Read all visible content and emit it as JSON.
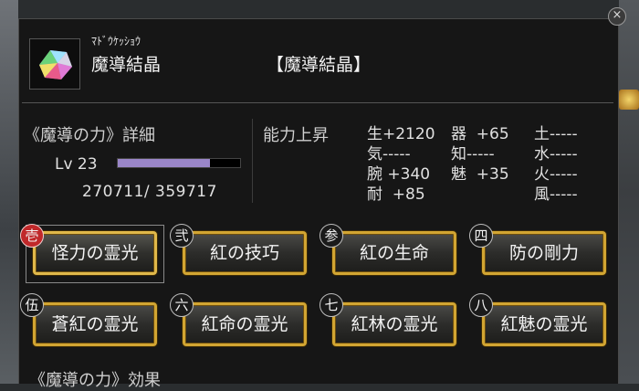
{
  "item": {
    "ruby": "ﾏﾄﾞｳｹｯｼｮｳ",
    "name": "魔導結晶",
    "bracket_name": "【魔導結晶】"
  },
  "power": {
    "title": "《魔導の力》詳細",
    "level_label": "Lv 23",
    "exp_text": "270711/  359717",
    "exp_progress": 0.752
  },
  "ability": {
    "title": "能力上昇",
    "col1": [
      "生+2120",
      "気-----",
      "腕 +340",
      "耐  +85"
    ],
    "col2": [
      "器  +65",
      "知-----",
      "魅  +35"
    ],
    "col3": [
      "土-----",
      "水-----",
      "火-----",
      "風-----"
    ]
  },
  "buttons": [
    {
      "badge": "壱",
      "label": "怪力の霊光",
      "active": true
    },
    {
      "badge": "弐",
      "label": "紅の技巧",
      "active": false
    },
    {
      "badge": "参",
      "label": "紅の生命",
      "active": false
    },
    {
      "badge": "四",
      "label": "防の剛力",
      "active": false
    },
    {
      "badge": "伍",
      "label": "蒼紅の霊光",
      "active": false
    },
    {
      "badge": "六",
      "label": "紅命の霊光",
      "active": false
    },
    {
      "badge": "七",
      "label": "紅林の霊光",
      "active": false
    },
    {
      "badge": "八",
      "label": "紅魅の霊光",
      "active": false
    }
  ],
  "effects_title": "《魔導の力》効果",
  "close_glyph": "×",
  "colors": {
    "gold_border": "#d2a532",
    "exp_bar": "#9a86c8",
    "active_badge": "#c0282a"
  },
  "icons": {
    "item": "crystal-icon",
    "close": "close-icon"
  }
}
